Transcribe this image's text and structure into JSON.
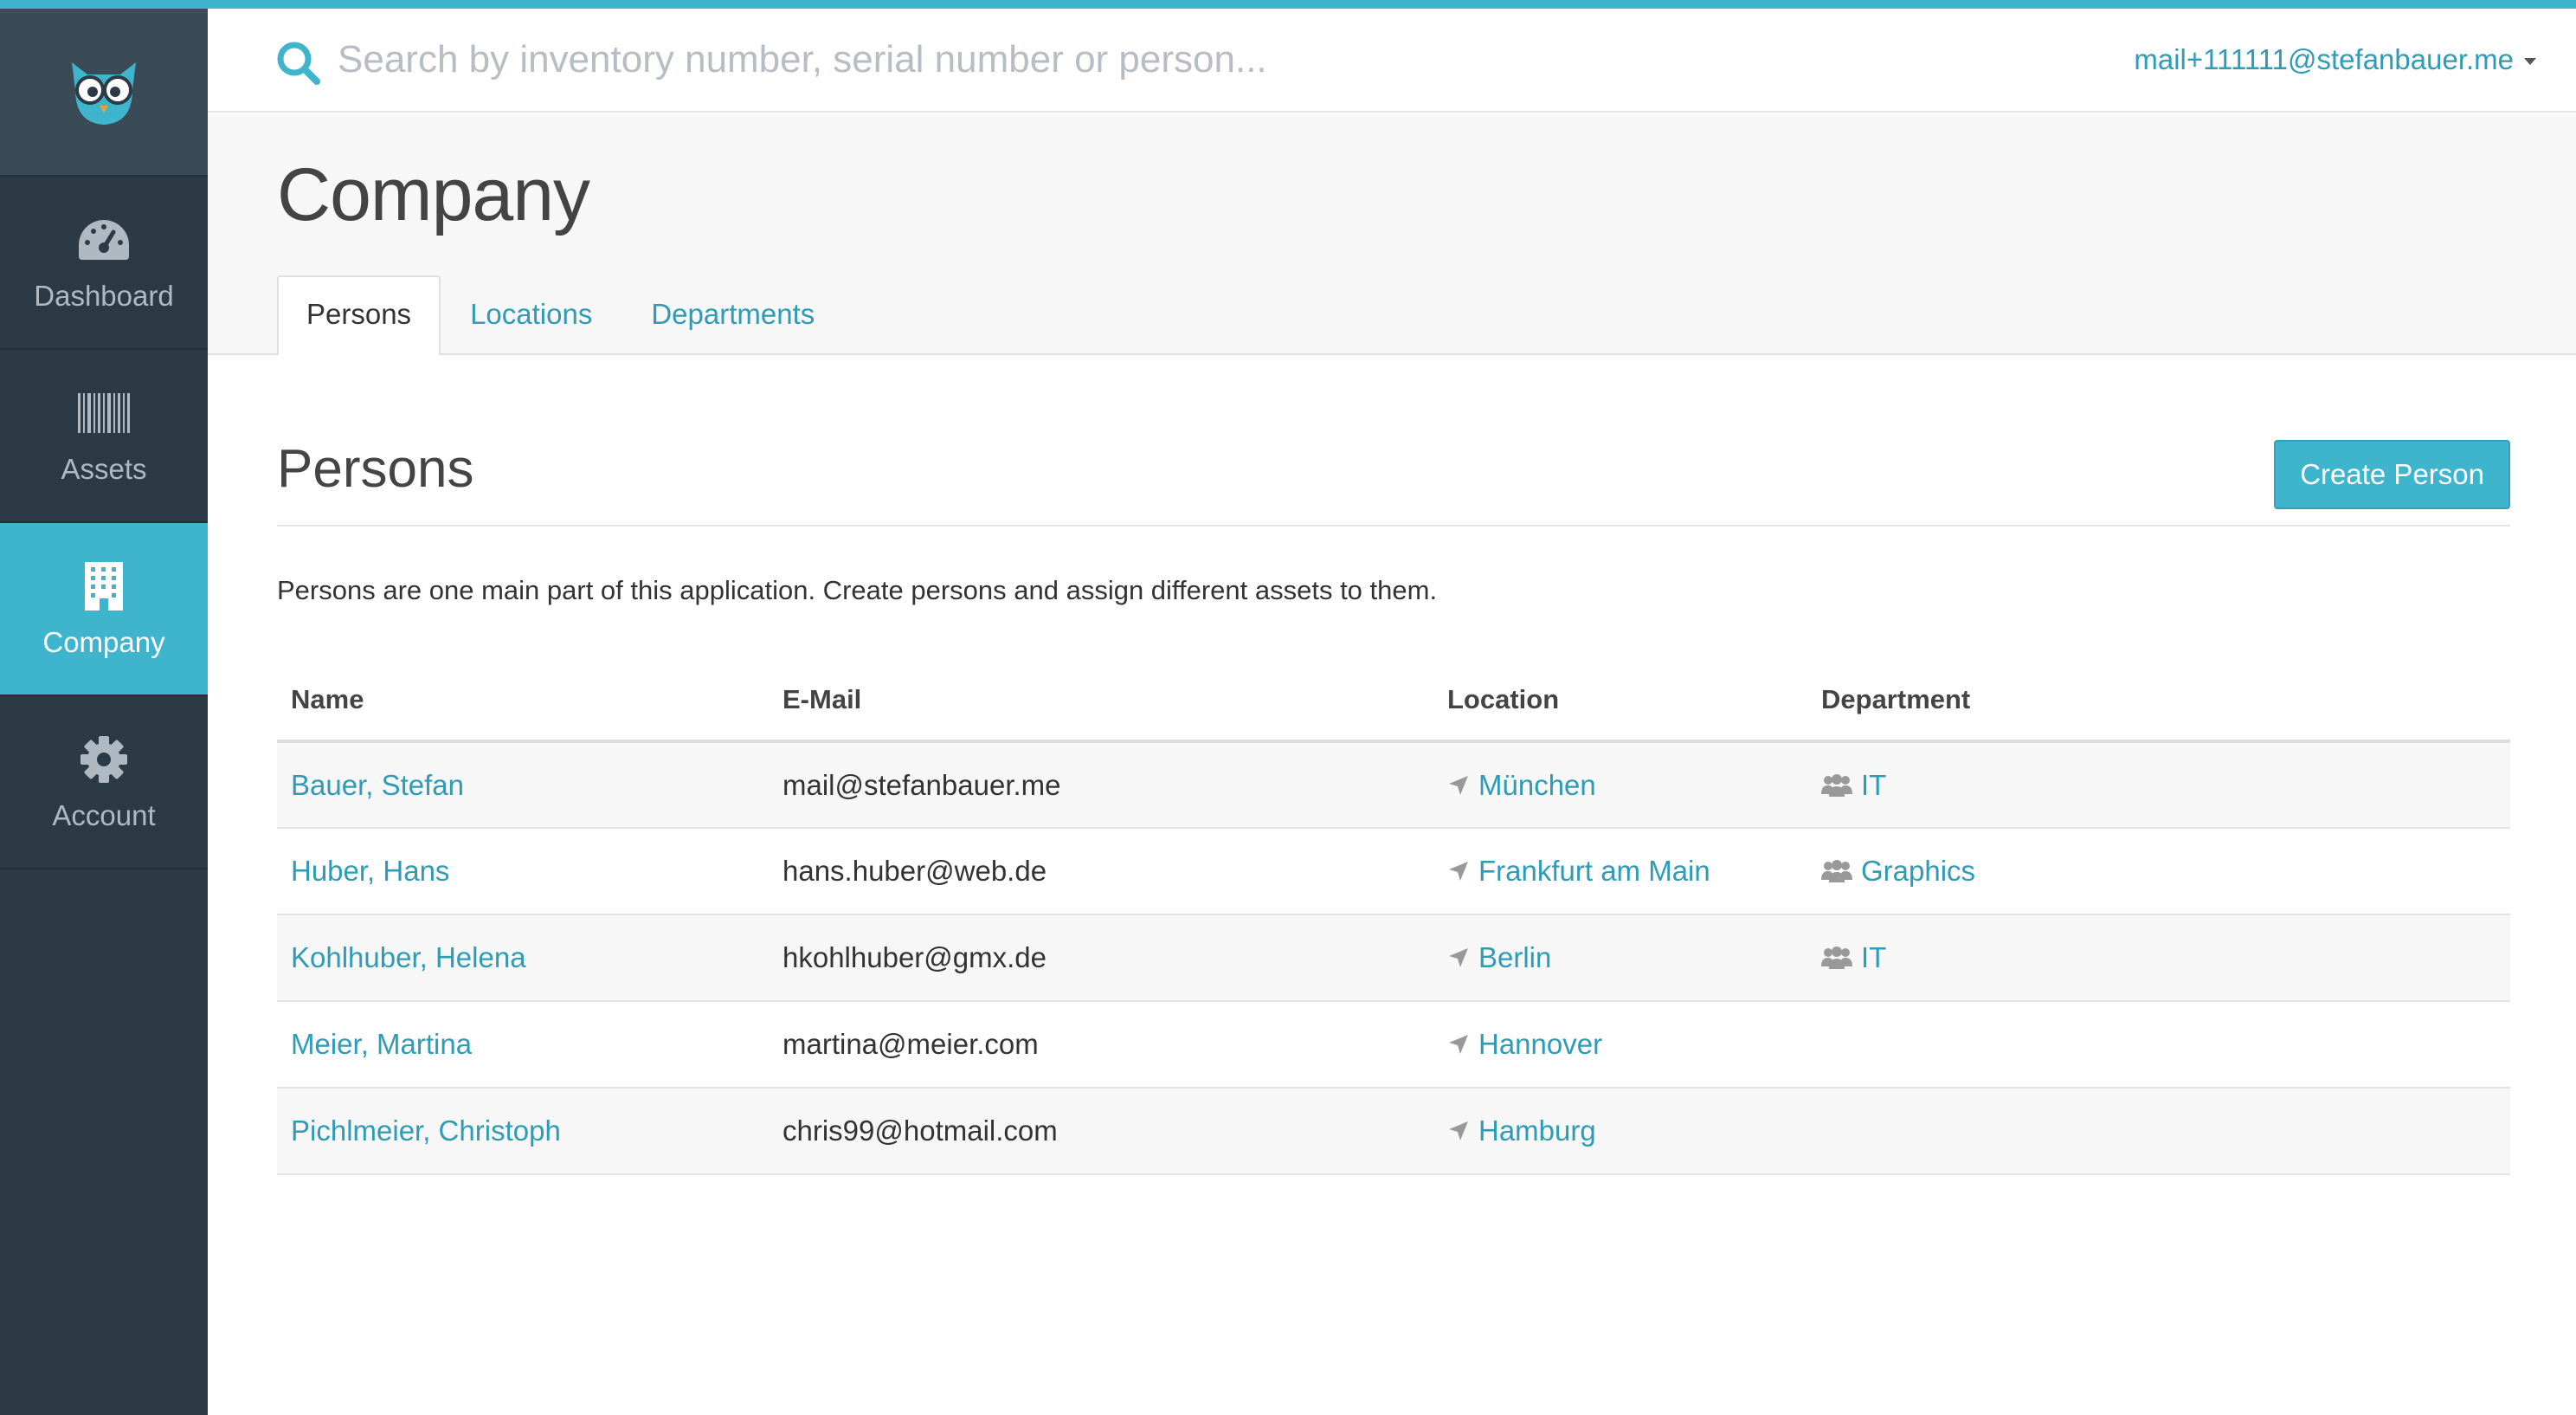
{
  "app": {
    "accent_color": "#3fb4cd",
    "sidebar_color": "#2c3a45",
    "logo": "owl-logo"
  },
  "sidebar": {
    "items": [
      {
        "label": "Dashboard",
        "icon": "speedometer-icon",
        "active": false
      },
      {
        "label": "Assets",
        "icon": "barcode-icon",
        "active": false
      },
      {
        "label": "Company",
        "icon": "building-icon",
        "active": true
      },
      {
        "label": "Account",
        "icon": "gear-icon",
        "active": false
      }
    ]
  },
  "header": {
    "search": {
      "placeholder": "Search by inventory number, serial number or person...",
      "value": ""
    },
    "user_email": "mail+111111@stefanbauer.me"
  },
  "page": {
    "title": "Company",
    "tabs": [
      {
        "label": "Persons",
        "active": true
      },
      {
        "label": "Locations",
        "active": false
      },
      {
        "label": "Departments",
        "active": false
      }
    ]
  },
  "section": {
    "title": "Persons",
    "create_button": "Create Person",
    "description": "Persons are one main part of this application. Create persons and assign different assets to them."
  },
  "table": {
    "columns": [
      "Name",
      "E-Mail",
      "Location",
      "Department"
    ],
    "rows": [
      {
        "name": "Bauer, Stefan",
        "email": "mail@stefanbauer.me",
        "location": "München",
        "department": "IT"
      },
      {
        "name": "Huber, Hans",
        "email": "hans.huber@web.de",
        "location": "Frankfurt am Main",
        "department": "Graphics"
      },
      {
        "name": "Kohlhuber, Helena",
        "email": "hkohlhuber@gmx.de",
        "location": "Berlin",
        "department": "IT"
      },
      {
        "name": "Meier, Martina",
        "email": "martina@meier.com",
        "location": "Hannover",
        "department": ""
      },
      {
        "name": "Pichlmeier, Christoph",
        "email": "chris99@hotmail.com",
        "location": "Hamburg",
        "department": ""
      }
    ]
  }
}
